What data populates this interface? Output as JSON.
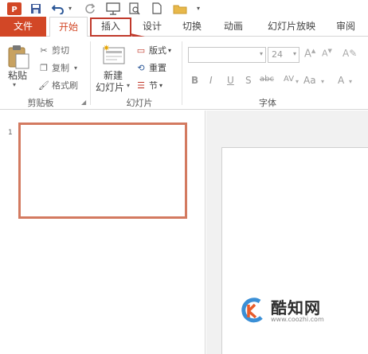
{
  "tabs": [
    "文件",
    "开始",
    "插入",
    "设计",
    "切换",
    "动画",
    "幻灯片放映",
    "审阅"
  ],
  "clipboard": {
    "paste": "粘贴",
    "cut": "剪切",
    "copy": "复制",
    "format_painter": "格式刷",
    "group_label": "剪贴板"
  },
  "slides": {
    "new_slide": "新建",
    "new_slide_2": "幻灯片",
    "layout": "版式",
    "reset": "重置",
    "section": "节",
    "group_label": "幻灯片"
  },
  "font": {
    "size": "24",
    "group_label": "字体",
    "buttons": [
      "B",
      "I",
      "U",
      "S",
      "abc",
      "AV",
      "Aa",
      "A"
    ]
  },
  "thumbnails": {
    "slide_number": "1"
  },
  "watermark": {
    "brand": "酷知网",
    "url": "www.coozhi.com"
  },
  "colors": {
    "accent": "#d24726",
    "highlight": "#c0392b"
  }
}
